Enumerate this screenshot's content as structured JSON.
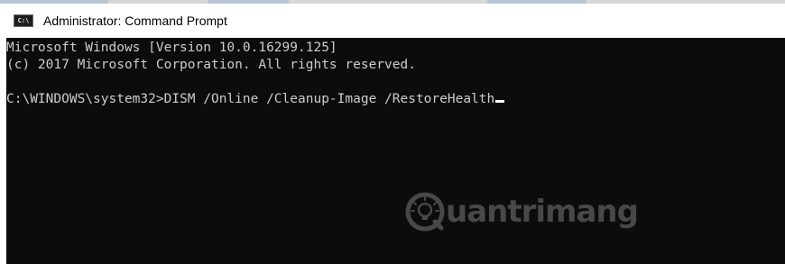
{
  "window": {
    "title": "Administrator: Command Prompt",
    "icon_label": "C:\\",
    "icon": "command-prompt-icon"
  },
  "console": {
    "lines": [
      "Microsoft Windows [Version 10.0.16299.125]",
      "(c) 2017 Microsoft Corporation. All rights reserved.",
      "",
      "C:\\WINDOWS\\system32>DISM /Online /Cleanup-Image /RestoreHealth"
    ],
    "background": "#0c0c0c",
    "text_color": "#cccccc"
  },
  "watermark": {
    "text": "uantrimang",
    "logo": "quantrimang-logo"
  }
}
